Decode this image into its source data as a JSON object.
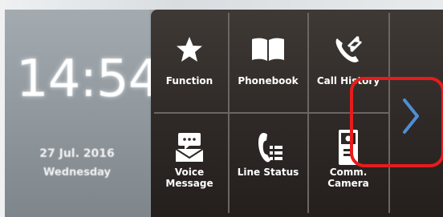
{
  "status": {
    "time": "14:54",
    "date": "27 Jul. 2016",
    "weekday": "Wednesday"
  },
  "menu": {
    "items": [
      {
        "label": "Function",
        "icon": "star-icon"
      },
      {
        "label": "Phonebook",
        "icon": "book-icon"
      },
      {
        "label": "Call History",
        "icon": "call-history-icon"
      },
      {
        "label": "Voice\nMessage",
        "icon": "voice-message-icon"
      },
      {
        "label": "Line Status",
        "icon": "line-status-icon"
      },
      {
        "label": "Comm.\nCamera",
        "icon": "camera-icon"
      }
    ],
    "next_icon": "chevron-right-icon"
  },
  "colors": {
    "panel": "#2e2926",
    "accent_arrow": "#4d8fd6",
    "highlight": "#e81b1b"
  }
}
